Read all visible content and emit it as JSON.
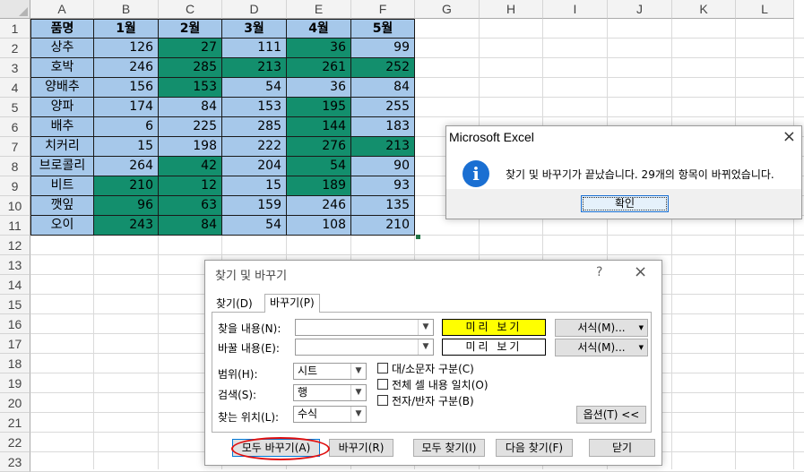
{
  "columns": [
    "A",
    "B",
    "C",
    "D",
    "E",
    "F",
    "G",
    "H",
    "I",
    "J",
    "K",
    "L"
  ],
  "rows": [
    "1",
    "2",
    "3",
    "4",
    "5",
    "6",
    "7",
    "8",
    "9",
    "10",
    "11",
    "12",
    "13",
    "14",
    "15",
    "16",
    "17",
    "18",
    "19",
    "20",
    "21",
    "22",
    "23"
  ],
  "table": {
    "headers": [
      "품명",
      "1월",
      "2월",
      "3월",
      "4월",
      "5월"
    ],
    "rows": [
      {
        "name": "상추",
        "values": [
          "126",
          "27",
          "111",
          "36",
          "99"
        ]
      },
      {
        "name": "호박",
        "values": [
          "246",
          "285",
          "213",
          "261",
          "252"
        ]
      },
      {
        "name": "양배추",
        "values": [
          "156",
          "153",
          "54",
          "36",
          "84"
        ]
      },
      {
        "name": "양파",
        "values": [
          "174",
          "84",
          "153",
          "195",
          "255"
        ]
      },
      {
        "name": "배추",
        "values": [
          "6",
          "225",
          "285",
          "144",
          "183"
        ]
      },
      {
        "name": "치커리",
        "values": [
          "15",
          "198",
          "222",
          "276",
          "213"
        ]
      },
      {
        "name": "브로콜리",
        "values": [
          "264",
          "42",
          "204",
          "54",
          "90"
        ]
      },
      {
        "name": "비트",
        "values": [
          "210",
          "12",
          "15",
          "189",
          "93"
        ]
      },
      {
        "name": "깻잎",
        "values": [
          "96",
          "63",
          "159",
          "246",
          "135"
        ]
      },
      {
        "name": "오이",
        "values": [
          "243",
          "84",
          "54",
          "108",
          "210"
        ]
      }
    ],
    "highlight_mask": [
      [
        0,
        1,
        0,
        1,
        0
      ],
      [
        0,
        1,
        1,
        1,
        1
      ],
      [
        0,
        1,
        0,
        0,
        0
      ],
      [
        0,
        0,
        0,
        1,
        0
      ],
      [
        0,
        0,
        0,
        1,
        0
      ],
      [
        0,
        0,
        0,
        1,
        1
      ],
      [
        0,
        1,
        0,
        1,
        0
      ],
      [
        1,
        1,
        0,
        1,
        0
      ],
      [
        1,
        1,
        0,
        0,
        0
      ],
      [
        1,
        1,
        0,
        0,
        0
      ]
    ]
  },
  "colors": {
    "light_blue": "#a6c8ea",
    "green": "#138f6d",
    "info_blue": "#1a6fd2",
    "annotation_red": "#e01010"
  },
  "message_box": {
    "title": "Microsoft Excel",
    "close_icon": "×",
    "info_icon": "i",
    "text": "찾기 및 바꾸기가 끝났습니다. 29개의 항목이 바뀌었습니다.",
    "ok_label": "확인"
  },
  "dialog": {
    "title": "찾기 및 바꾸기",
    "help": "?",
    "close_icon": "×",
    "tabs": [
      "찾기(D)",
      "바꾸기(P)"
    ],
    "find_label": "찾을 내용(N):",
    "replace_label": "바꿀 내용(E):",
    "find_value": "",
    "replace_value": "",
    "preview_label": "미리 보기",
    "format_label": "서식(M)...",
    "scope_label": "범위(H):",
    "scope_value": "시트",
    "search_label": "검색(S):",
    "search_value": "행",
    "lookin_label": "찾는 위치(L):",
    "lookin_value": "수식",
    "match_case": "대/소문자 구분(C)",
    "match_entire": "전체 셀 내용 일치(O)",
    "match_byte": "전자/반자 구분(B)",
    "options_label": "옵션(T) <<",
    "replace_all": "모두 바꾸기(A)",
    "replace": "바꾸기(R)",
    "find_all": "모두 찾기(I)",
    "find_next": "다음 찾기(F)",
    "close": "닫기"
  }
}
